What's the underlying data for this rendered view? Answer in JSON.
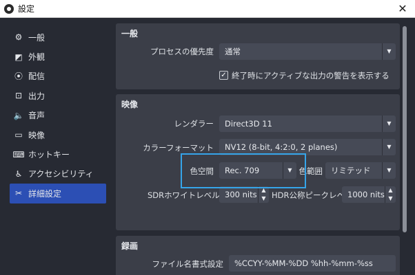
{
  "window": {
    "title": "設定",
    "close": "✕"
  },
  "sidebar": {
    "items": [
      {
        "label": "一般",
        "icon": "gear-icon",
        "glyph": "⚙"
      },
      {
        "label": "外観",
        "icon": "palette-icon",
        "glyph": "◩"
      },
      {
        "label": "配信",
        "icon": "broadcast-icon",
        "glyph": "⦿"
      },
      {
        "label": "出力",
        "icon": "output-icon",
        "glyph": "⊡"
      },
      {
        "label": "音声",
        "icon": "speaker-icon",
        "glyph": "🔈"
      },
      {
        "label": "映像",
        "icon": "monitor-icon",
        "glyph": "▭"
      },
      {
        "label": "ホットキー",
        "icon": "keyboard-icon",
        "glyph": "⌨"
      },
      {
        "label": "アクセシビリティ",
        "icon": "accessibility-icon",
        "glyph": "♿"
      },
      {
        "label": "詳細設定",
        "icon": "wrench-icon",
        "glyph": "✂"
      }
    ],
    "active_index": 8
  },
  "general": {
    "title": "一般",
    "process_priority_label": "プロセスの優先度",
    "process_priority_value": "通常",
    "warn_checkbox_label": "終了時にアクティブな出力の警告を表示する",
    "warn_checked": true
  },
  "video": {
    "title": "映像",
    "renderer_label": "レンダラー",
    "renderer_value": "Direct3D 11",
    "color_format_label": "カラーフォーマット",
    "color_format_value": "NV12 (8-bit, 4:2:0, 2 planes)",
    "color_space_label": "色空間",
    "color_space_value": "Rec. 709",
    "color_range_label": "色範囲",
    "color_range_value": "リミテッド",
    "sdr_white_label": "SDRホワイトレベル",
    "sdr_white_value": "300 nits",
    "hdr_peak_label": "HDR公称ピークレベル",
    "hdr_peak_value": "1000 nits"
  },
  "recording": {
    "title": "録画",
    "filename_format_label": "ファイル名書式設定",
    "filename_format_value": "%CCYY-%MM-%DD %hh-%mm-%ss"
  },
  "colors": {
    "accent": "#2c4fb4",
    "highlight": "#35a5ea"
  }
}
